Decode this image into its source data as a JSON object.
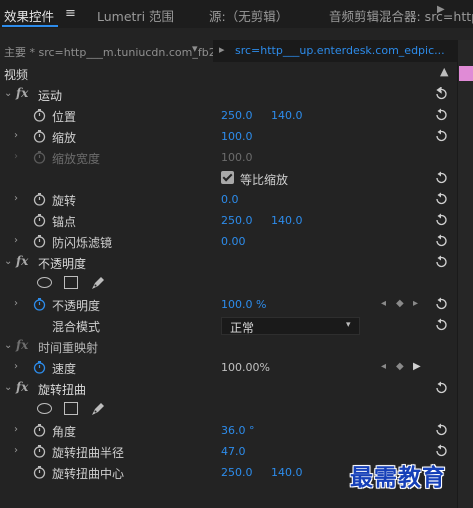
{
  "tabs": [
    {
      "label": "效果控件",
      "active": true
    },
    {
      "label": "Lumetri 范围",
      "active": false
    },
    {
      "label": "源:（无剪辑）",
      "active": false
    },
    {
      "label": "音频剪辑混合器: src=http",
      "active": false
    }
  ],
  "tab_menu_icon": "hamburger-menu-icon",
  "clipbar": {
    "master_clip": "主要 * src=http___m.tuniucdn.com_fb2...",
    "sequence_clip": "src=http___up.enterdesk.com_edpic..."
  },
  "video_section": {
    "label": "视频",
    "collapse_icon": "chevron-up-icon"
  },
  "effects": {
    "motion": {
      "label": "运动",
      "position": {
        "label": "位置",
        "x": "250.0",
        "y": "140.0"
      },
      "scale": {
        "label": "缩放",
        "value": "100.0"
      },
      "scale_width": {
        "label": "缩放宽度",
        "value": "100.0"
      },
      "uniform_scale": {
        "label": "等比缩放",
        "checked": true
      },
      "rotation": {
        "label": "旋转",
        "value": "0.0"
      },
      "anchor": {
        "label": "锚点",
        "x": "250.0",
        "y": "140.0"
      },
      "anti_flicker": {
        "label": "防闪烁滤镜",
        "value": "0.00"
      }
    },
    "opacity": {
      "label": "不透明度",
      "opacity_prop": {
        "label": "不透明度",
        "value": "100.0 %"
      },
      "blend_mode": {
        "label": "混合模式",
        "value": "正常"
      }
    },
    "time_remap": {
      "label": "时间重映射",
      "speed": {
        "label": "速度",
        "value": "100.00%"
      }
    },
    "twirl": {
      "label": "旋转扭曲",
      "angle": {
        "label": "角度",
        "value": "36.0 °"
      },
      "radius": {
        "label": "旋转扭曲半径",
        "value": "47.0"
      },
      "center": {
        "label": "旋转扭曲中心",
        "x": "250.0",
        "y": "140.0"
      }
    }
  },
  "watermark": "最需教育",
  "colors": {
    "accent": "#2d8ceb",
    "panel": "#232323",
    "clip_marker": "#e08bd6"
  }
}
